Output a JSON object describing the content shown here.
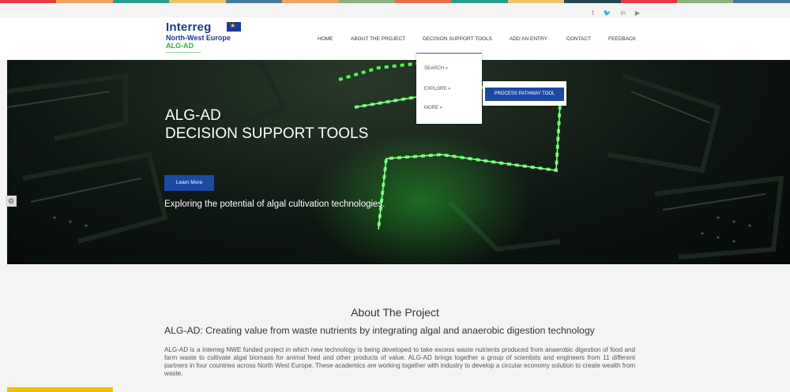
{
  "colors": {
    "topbar": [
      "#e63946",
      "#f4a261",
      "#2a9d8f",
      "#e9c46a",
      "#457b9d",
      "#f4a261",
      "#8ab17d",
      "#e76f51",
      "#2a9d8f",
      "#e9c46a",
      "#264653",
      "#e63946",
      "#8ab17d",
      "#457b9d"
    ],
    "brand_blue": "#1c4aa3",
    "accent_green": "#4cff4c"
  },
  "social": [
    "f",
    "🐦",
    "in",
    "▶"
  ],
  "logo": {
    "line1": "Interreg",
    "line2": "North-West Europe",
    "line3": "ALG-AD"
  },
  "nav": [
    {
      "label": "HOME"
    },
    {
      "label": "ABOUT THE PROJECT"
    },
    {
      "label": "DECISION SUPPORT TOOLS"
    },
    {
      "label": "ADD AN ENTRY"
    },
    {
      "label": "CONTACT"
    },
    {
      "label": "FEEDBACK"
    }
  ],
  "dropdown": [
    "SEARCH »",
    "EXPLORE »",
    "MORE »"
  ],
  "submenu_button": "PROCESS PATHWAY TOOL",
  "hero": {
    "title_line1": "ALG-AD",
    "title_line2": "DECISION SUPPORT TOOLS",
    "button": "Learn More",
    "subtitle": "Exploring the potential of algal cultivation technologies."
  },
  "about": {
    "title": "About The Project",
    "subtitle": "ALG-AD: Creating value from waste nutrients by integrating algal and anaerobic digestion technology",
    "body": "ALG-AD is a Interreg NWE funded project in which new technology is being developed to take excess waste nutrients produced from anaerobic digestion of food and farm waste to cultivate algal biomass for animal feed and other products of value. ALG-AD brings together a group of scientists and engineers from 11 different partners in four countries across North West Europe. These academics are working together with industry to develop a circular economy solution to create wealth from waste."
  }
}
